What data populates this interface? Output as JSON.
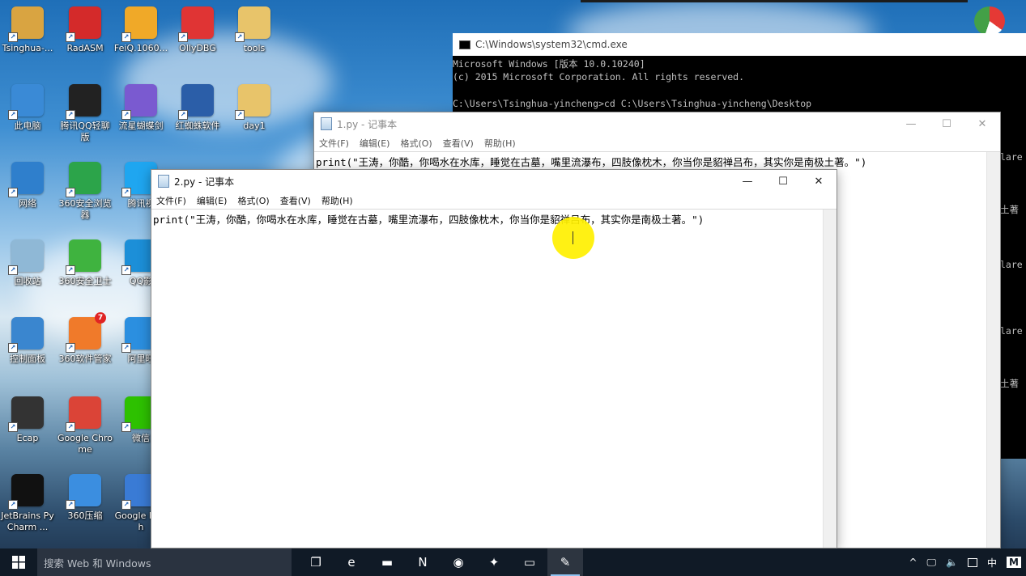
{
  "desktop": {
    "icons": [
      {
        "label": "Tsinghua-...",
        "icon": "user-folder-icon",
        "color": "#d9a441"
      },
      {
        "label": "RadASM",
        "icon": "radasm-icon",
        "color": "#d42a2a"
      },
      {
        "label": "FeiQ.1060...",
        "icon": "feiq-chat-icon",
        "color": "#f0a928"
      },
      {
        "label": "OllyDBG",
        "icon": "ollydbg-icon",
        "color": "#e03434"
      },
      {
        "label": "tools",
        "icon": "folder-icon",
        "color": "#e8c46a"
      },
      {
        "label": "此电脑",
        "icon": "this-pc-icon",
        "color": "#3a8ad6"
      },
      {
        "label": "腾讯QQ轻聊版",
        "icon": "qq-penguin-icon",
        "color": "#222222"
      },
      {
        "label": "流星蝴蝶剑",
        "icon": "butterfly-game-icon",
        "color": "#7a5ad0"
      },
      {
        "label": "红蜘蛛软件",
        "icon": "red-spider-icon",
        "color": "#2b5ea8"
      },
      {
        "label": "day1",
        "icon": "folder-icon",
        "color": "#e8c46a"
      },
      {
        "label": "网络",
        "icon": "network-icon",
        "color": "#2f7fcc"
      },
      {
        "label": "360安全浏览器",
        "icon": "360-browser-icon",
        "color": "#2ca44a"
      },
      {
        "label": "腾讯视",
        "icon": "tencent-video-icon",
        "color": "#1fa6f0"
      },
      {
        "label": "回收站",
        "icon": "recycle-bin-icon",
        "color": "#8fb8d6"
      },
      {
        "label": "360安全卫士",
        "icon": "360-guard-icon",
        "color": "#3fb33f"
      },
      {
        "label": "QQ影",
        "icon": "qq-player-icon",
        "color": "#1c8fd8"
      },
      {
        "label": "控制面板",
        "icon": "control-panel-icon",
        "color": "#3a86cf"
      },
      {
        "label": "360软件管家",
        "icon": "360-software-icon",
        "color": "#f07a2a"
      },
      {
        "label": "阿里旺",
        "icon": "aliwangwang-icon",
        "color": "#2b8fe0"
      },
      {
        "label": "Ecap",
        "icon": "camera-icon",
        "color": "#333333"
      },
      {
        "label": "Google Chrome",
        "icon": "chrome-icon",
        "color": "#db4437"
      },
      {
        "label": "微信",
        "icon": "wechat-icon",
        "color": "#2dc100"
      },
      {
        "label": "JetBrains PyCharm ...",
        "icon": "pycharm-icon",
        "color": "#111111"
      },
      {
        "label": "360压缩",
        "icon": "360-zip-icon",
        "color": "#3b8ee0"
      },
      {
        "label": "Google Earth",
        "icon": "google-earth-icon",
        "color": "#3a7bd5"
      }
    ],
    "badge_360_software": "7"
  },
  "cmd": {
    "title": "C:\\Windows\\system32\\cmd.exe",
    "lines": [
      "Microsoft Windows [版本 10.0.10240]",
      "(c) 2015 Microsoft Corporation. All rights reserved.",
      "",
      "C:\\Users\\Tsinghua-yincheng>cd  C:\\Users\\Tsinghua-yincheng\\Desktop"
    ],
    "right_fragments": [
      "lare",
      "土著",
      "lare",
      "lare",
      "土著"
    ]
  },
  "notepad1": {
    "title": "1.py - 记事本",
    "menu": [
      "文件(F)",
      "编辑(E)",
      "格式(O)",
      "查看(V)",
      "帮助(H)"
    ],
    "content": "print(\"王涛，你酷，你喝水在水库，睡觉在古墓，嘴里流瀑布，四肢像枕木，你当你是貂禅吕布，其实你是南极土著。\")"
  },
  "notepad2": {
    "title": "2.py - 记事本",
    "menu": [
      "文件(F)",
      "编辑(E)",
      "格式(O)",
      "查看(V)",
      "帮助(H)"
    ],
    "content": "print(\"王涛，你酷，你喝水在水库，睡觉在古墓，嘴里流瀑布，四肢像枕木，你当你是貂禅吕布，其实你是南极土著。\")"
  },
  "window_controls": {
    "minimize": "—",
    "maximize": "☐",
    "close": "✕"
  },
  "taskbar": {
    "search_placeholder": "搜索 Web 和 Windows",
    "apps": [
      {
        "name": "task-view",
        "glyph": "❐"
      },
      {
        "name": "edge",
        "glyph": "e"
      },
      {
        "name": "file-explorer",
        "glyph": "▬"
      },
      {
        "name": "onenote",
        "glyph": "N"
      },
      {
        "name": "chrome",
        "glyph": "◉"
      },
      {
        "name": "ecap-app",
        "glyph": "✦"
      },
      {
        "name": "cmd",
        "glyph": "▭"
      },
      {
        "name": "notepad",
        "glyph": "✎"
      }
    ],
    "tray": {
      "chevron": "^",
      "network": "🖵",
      "volume": "🔈",
      "ime": "中",
      "tray_app": "M"
    }
  },
  "colors": {
    "taskbar": "#101a26",
    "accent": "#8fc2f0",
    "cursor_highlight": "#ffee00"
  }
}
